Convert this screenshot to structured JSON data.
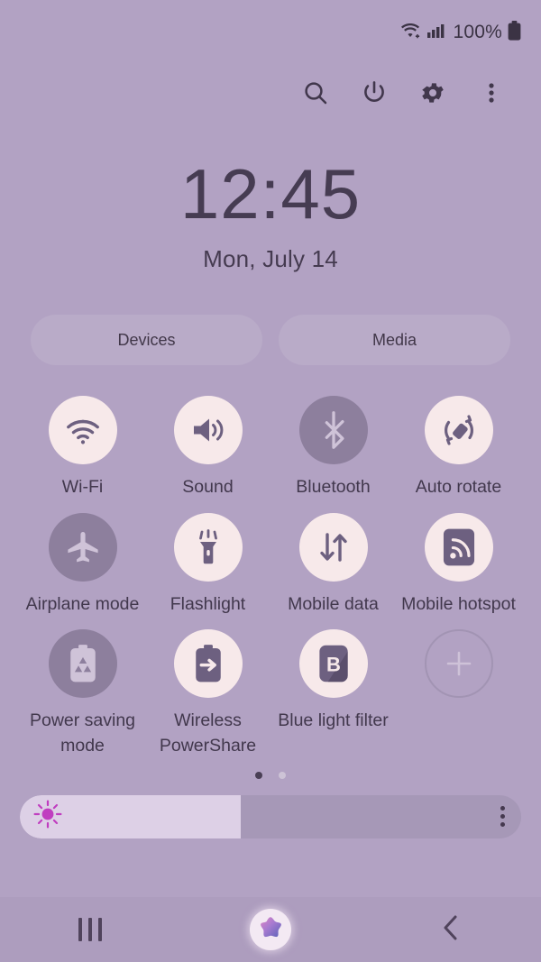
{
  "status_bar": {
    "wifi_icon": "wifi-data-icon",
    "signal_icon": "cellular-signal-icon",
    "battery_percent": "100%",
    "battery_icon": "battery-full-icon"
  },
  "toolbar": {
    "buttons": [
      {
        "name": "search-icon",
        "label": "Search"
      },
      {
        "name": "power-icon",
        "label": "Power"
      },
      {
        "name": "settings-gear-icon",
        "label": "Settings"
      },
      {
        "name": "overflow-menu-icon",
        "label": "More options"
      }
    ]
  },
  "clock": {
    "time": "12:45",
    "date": "Mon, July 14"
  },
  "chips": [
    {
      "label": "Devices"
    },
    {
      "label": "Media"
    }
  ],
  "quick_settings": {
    "tiles": [
      {
        "label": "Wi-Fi",
        "icon": "wifi-icon",
        "state": "on"
      },
      {
        "label": "Sound",
        "icon": "sound-icon",
        "state": "on"
      },
      {
        "label": "Bluetooth",
        "icon": "bluetooth-icon",
        "state": "off"
      },
      {
        "label": "Auto rotate",
        "icon": "auto-rotate-icon",
        "state": "on"
      },
      {
        "label": "Airplane mode",
        "icon": "airplane-icon",
        "state": "off"
      },
      {
        "label": "Flashlight",
        "icon": "flashlight-icon",
        "state": "on"
      },
      {
        "label": "Mobile data",
        "icon": "mobile-data-icon",
        "state": "on"
      },
      {
        "label": "Mobile hotspot",
        "icon": "mobile-hotspot-icon",
        "state": "on"
      },
      {
        "label": "Power saving mode",
        "icon": "power-saving-icon",
        "state": "off"
      },
      {
        "label": "Wireless PowerShare",
        "icon": "power-share-icon",
        "state": "on"
      },
      {
        "label": "Blue light filter",
        "icon": "blue-light-icon",
        "state": "on"
      },
      {
        "label": "",
        "icon": "add-tile-icon",
        "state": "add"
      }
    ],
    "page_dots": {
      "count": 2,
      "active_index": 0
    }
  },
  "brightness": {
    "level_percent": 44,
    "sun_icon": "brightness-sun-icon",
    "menu_icon": "brightness-options-icon"
  },
  "nav_bar": {
    "recents_label": "Recents",
    "home_label": "Home",
    "back_label": "Back"
  },
  "colors": {
    "background": "#b2a2c3",
    "tile_on": "#f7e9ea",
    "tile_off": "#8d7f9d",
    "glyph_on": "#6d6080",
    "glyph_off": "#cfc3d8",
    "text": "#42384d",
    "accent_sun": "#c03ec0",
    "nav_bar": "#ad9dbe"
  }
}
